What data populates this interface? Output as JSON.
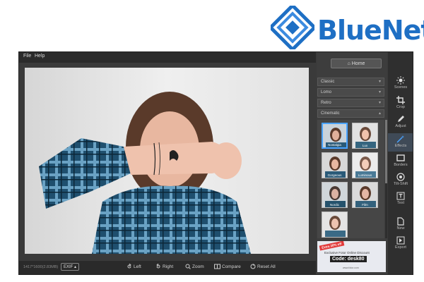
{
  "logo": {
    "text": "BlueNet",
    "color": "#1e6fc4"
  },
  "menu": {
    "items": [
      "File",
      "Help"
    ]
  },
  "bottom": {
    "size_info": "1417*1600(2.83MB)",
    "exif": "EXIF",
    "tools": [
      "Left",
      "Right",
      "Zoom",
      "Compare",
      "Reset All"
    ]
  },
  "panel": {
    "home": "Home",
    "categories": [
      "Classic",
      "Lomo",
      "Retro",
      "Cinematic"
    ],
    "thumbs": [
      "Nostalgia",
      "Lux",
      "Gorgeous",
      "Luminous",
      "Nordic",
      "Film",
      ""
    ],
    "ad": {
      "badge": "Extra 20% off",
      "line": "Exclusive Fotor Online Discount",
      "code": "Code: desk80",
      "url": "www.fotor.com"
    }
  },
  "toolbar": {
    "items": [
      "Scenes",
      "Crop",
      "Adjust",
      "Effects",
      "Borders",
      "Tilt-Shift",
      "Text",
      "New",
      "Export"
    ],
    "active": "Effects"
  },
  "colors": {
    "accent": "#4aa3ff",
    "window": "#3a3a3a"
  }
}
